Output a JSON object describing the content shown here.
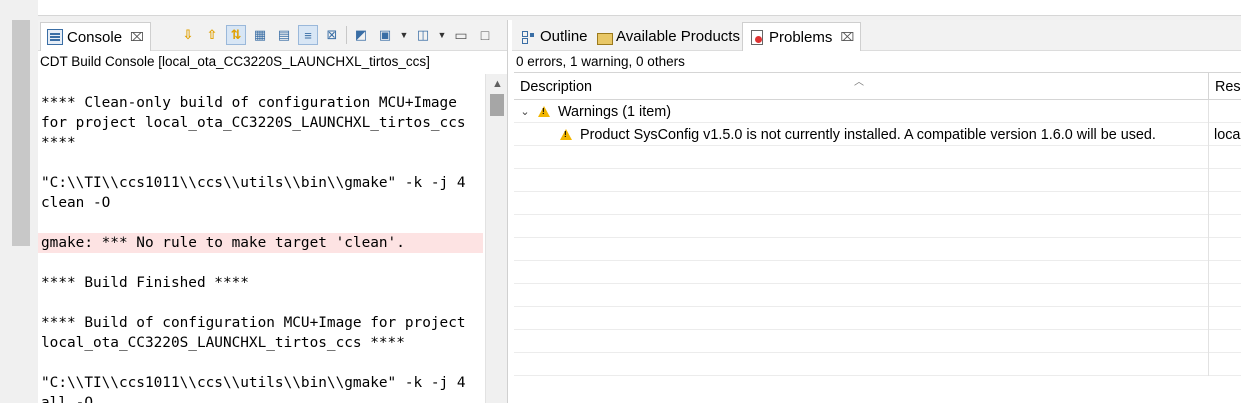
{
  "console": {
    "tab_label": "Console",
    "close_glyph": "⌧",
    "title": "CDT Build Console [local_ota_CC3220S_LAUNCHXL_tirtos_ccs]",
    "lines": [
      "**** Clean-only build of configuration MCU+Image",
      "for project local_ota_CC3220S_LAUNCHXL_tirtos_ccs",
      "****",
      "\"C:\\\\TI\\\\ccs1011\\\\ccs\\\\utils\\\\bin\\\\gmake\" -k -j 4",
      "clean -O",
      "gmake: *** No rule to make target 'clean'.",
      "**** Build Finished ****",
      "**** Build of configuration MCU+Image for project",
      "local_ota_CC3220S_LAUNCHXL_tirtos_ccs ****",
      "\"C:\\\\TI\\\\ccs1011\\\\ccs\\\\utils\\\\bin\\\\gmake\" -k -j 4",
      "all -O"
    ],
    "toolbar_icons": [
      "scroll-down-icon",
      "scroll-up-icon",
      "scroll-lock-icon",
      "clear-console-icon",
      "word-wrap-icon",
      "pin-console-icon",
      "display-console-icon",
      "new-console-icon",
      "minimize-icon",
      "maximize-icon"
    ]
  },
  "problems": {
    "tabs": [
      {
        "label": "Outline"
      },
      {
        "label": "Available Products"
      },
      {
        "label": "Problems"
      }
    ],
    "close_glyph": "⌧",
    "summary": "0 errors, 1 warning, 0 others",
    "columns": [
      "Description",
      "Reso"
    ],
    "group": {
      "label": "Warnings (1 item)",
      "expanded": true
    },
    "items": [
      {
        "description": "Product SysConfig v1.5.0 is not currently installed. A compatible version 1.6.0 will be used.",
        "resource": "loca"
      }
    ]
  },
  "colors": {
    "error_line_bg": "#fde3e3",
    "warning": "#f2b600",
    "accent": "#3a6ea5"
  }
}
